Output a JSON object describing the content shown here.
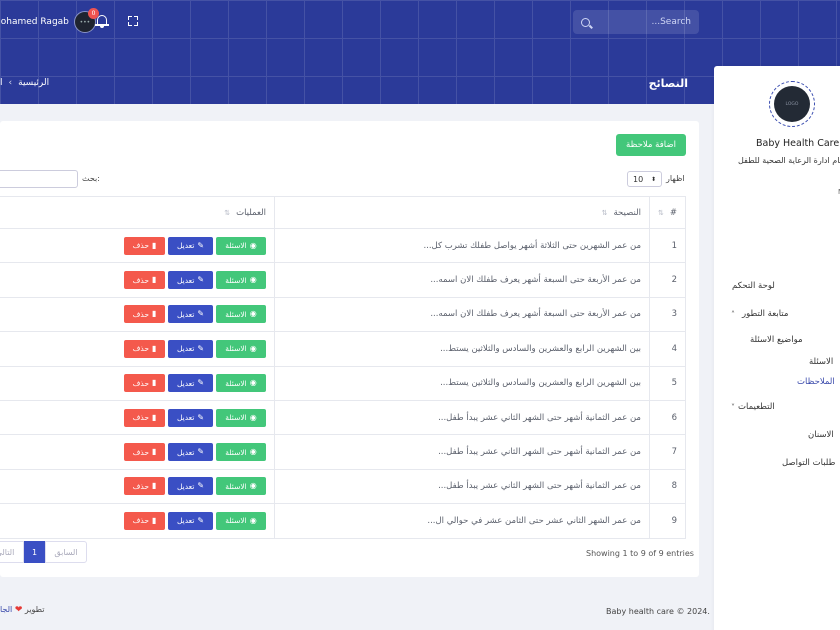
{
  "header": {
    "search_placeholder": "...Search",
    "user_name": "Mohamed Ragab",
    "avatar_text": "•••",
    "notification_count": "0",
    "page_title": "النصائح",
    "breadcrumb": [
      "الرئيسية",
      "›",
      "ا"
    ]
  },
  "sidebar": {
    "logo_text": "LOGO",
    "brand": "Baby Health Care",
    "subtitle": "نظام ادارة الرعاية الصحية للطفل",
    "small_label": "M",
    "items": [
      {
        "label": "لوحة التحكم"
      },
      {
        "label": "متابعة التطور",
        "chevron": "˄"
      },
      {
        "label": "مواضيع الاسئلة"
      },
      {
        "label": "الاسئلة"
      },
      {
        "label": "الملاحظات"
      },
      {
        "label": "التطعيمات",
        "chevron": "˅"
      },
      {
        "label": "الاسنان"
      },
      {
        "label": "طلبات التواصل"
      }
    ]
  },
  "content": {
    "add_button": "اضافة ملاحظة",
    "show_label": "اظهار",
    "length_value": "10",
    "search_label": "بحث:",
    "columns": [
      "#",
      "النصيحة",
      "العمليات"
    ],
    "buttons": {
      "questions": "الاسئلة",
      "edit": "تعديل",
      "delete": "حذف"
    },
    "rows": [
      {
        "num": "1",
        "text": "من عمر الشهرين حتى الثلاثة أشهر يواصل طفلك تشرب كل..."
      },
      {
        "num": "2",
        "text": "من عمر الأربعة حتى السبعة أشهر يعرف طفلك الان اسمه..."
      },
      {
        "num": "3",
        "text": "من عمر الأربعة حتى السبعة أشهر يعرف طفلك الان اسمه..."
      },
      {
        "num": "4",
        "text": "بين الشهرين الرابع والعشرين والسادس والثلاثين يستط..."
      },
      {
        "num": "5",
        "text": "بين الشهرين الرابع والعشرين والسادس والثلاثين يستط..."
      },
      {
        "num": "6",
        "text": "من عمر الثمانية أشهر حتى الشهر الثاني عشر يبدأ طفل..."
      },
      {
        "num": "7",
        "text": "من عمر الثمانية أشهر حتى الشهر الثاني عشر يبدأ طفل..."
      },
      {
        "num": "8",
        "text": "من عمر الثمانية أشهر حتى الشهر الثاني عشر يبدأ طفل..."
      },
      {
        "num": "9",
        "text": "من عمر الشهر الثاني عشر حتى الثامن عشر في حوالي ال..."
      }
    ],
    "entries_info": "Showing 1 to 9 of 9 entries",
    "pager": {
      "prev": "السابق",
      "current": "1",
      "next": "التالي"
    }
  },
  "footer": {
    "copyright": "Baby health care © 2024.",
    "dev_label": "تطوير",
    "dev_link": "الجا"
  }
}
